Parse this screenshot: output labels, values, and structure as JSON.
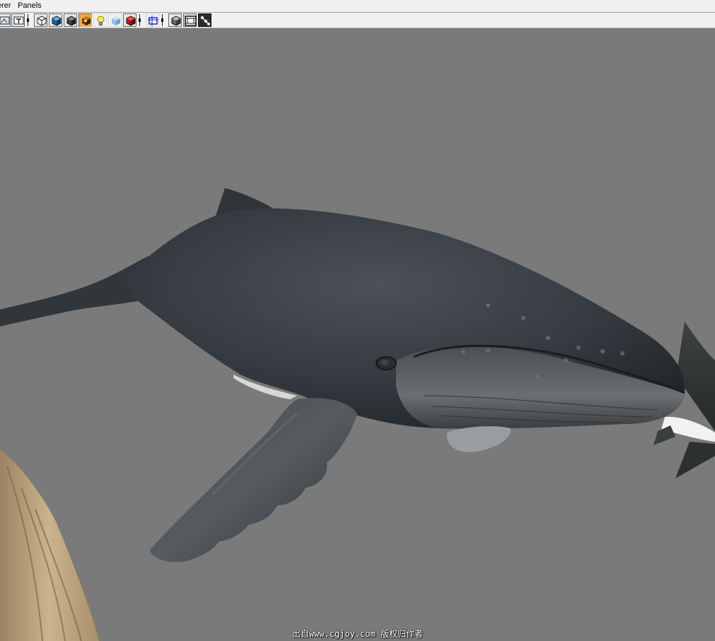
{
  "menubar": {
    "items": [
      {
        "label": "erer"
      },
      {
        "label": "Panels"
      }
    ]
  },
  "toolbar": {
    "buttons": [
      {
        "icon": "camera-frame-icon"
      },
      {
        "icon": "text-frame-icon"
      },
      {
        "icon": "wireframe-cube-icon"
      },
      {
        "icon": "smooth-shade-cube-icon"
      },
      {
        "icon": "textured-cube-icon"
      },
      {
        "icon": "shadow-cube-icon"
      },
      {
        "icon": "light-bulb-icon"
      },
      {
        "icon": "xray-cube-icon"
      },
      {
        "icon": "red-cube-icon"
      },
      {
        "icon": "resolution-gate-icon"
      },
      {
        "icon": "isolate-cube-icon"
      },
      {
        "icon": "film-gate-icon"
      },
      {
        "icon": "joint-icon"
      }
    ]
  },
  "viewport": {
    "background": "#7a7a7a",
    "watermark": "出自www.cgjoy.com 版权归作者"
  }
}
